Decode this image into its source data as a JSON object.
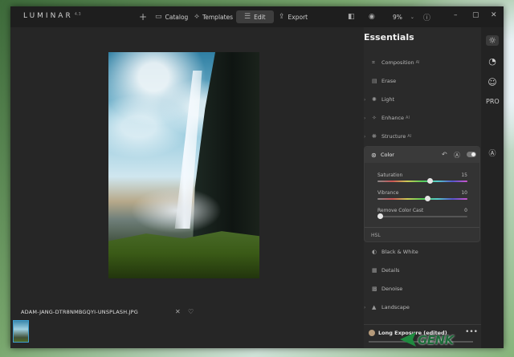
{
  "app": {
    "logo": "LUMINAR",
    "version": "4.3"
  },
  "toolbar": {
    "add_label": "+",
    "catalog_label": "Catalog",
    "templates_label": "Templates",
    "edit_label": "Edit",
    "export_label": "Export",
    "zoom": "9%"
  },
  "panel": {
    "title": "Essentials",
    "sections_top": [
      {
        "label": "Composition",
        "icon": "crop-icon",
        "ai": true
      },
      {
        "label": "Erase",
        "icon": "eraser-icon",
        "ai": false
      },
      {
        "label": "Light",
        "icon": "sun-icon",
        "ai": false
      },
      {
        "label": "Enhance",
        "icon": "enhance-icon",
        "ai": true
      },
      {
        "label": "Structure",
        "icon": "structure-icon",
        "ai": true
      }
    ],
    "color": {
      "title": "Color",
      "sliders": [
        {
          "label": "Saturation",
          "value": "15"
        },
        {
          "label": "Vibrance",
          "value": "10"
        },
        {
          "label": "Remove Color Cast",
          "value": "0"
        }
      ],
      "hsl_label": "HSL"
    },
    "sections_bottom": [
      {
        "label": "Black & White"
      },
      {
        "label": "Details"
      },
      {
        "label": "Denoise"
      },
      {
        "label": "Landscape"
      }
    ],
    "look": {
      "title": "Long Exposure (edited)",
      "menu": "•••"
    }
  },
  "photo": {
    "filename": "ADAM-JANG-DTR8NMBGQYI-UNSPLASH.JPG"
  },
  "watermark": {
    "text": "GENK"
  }
}
